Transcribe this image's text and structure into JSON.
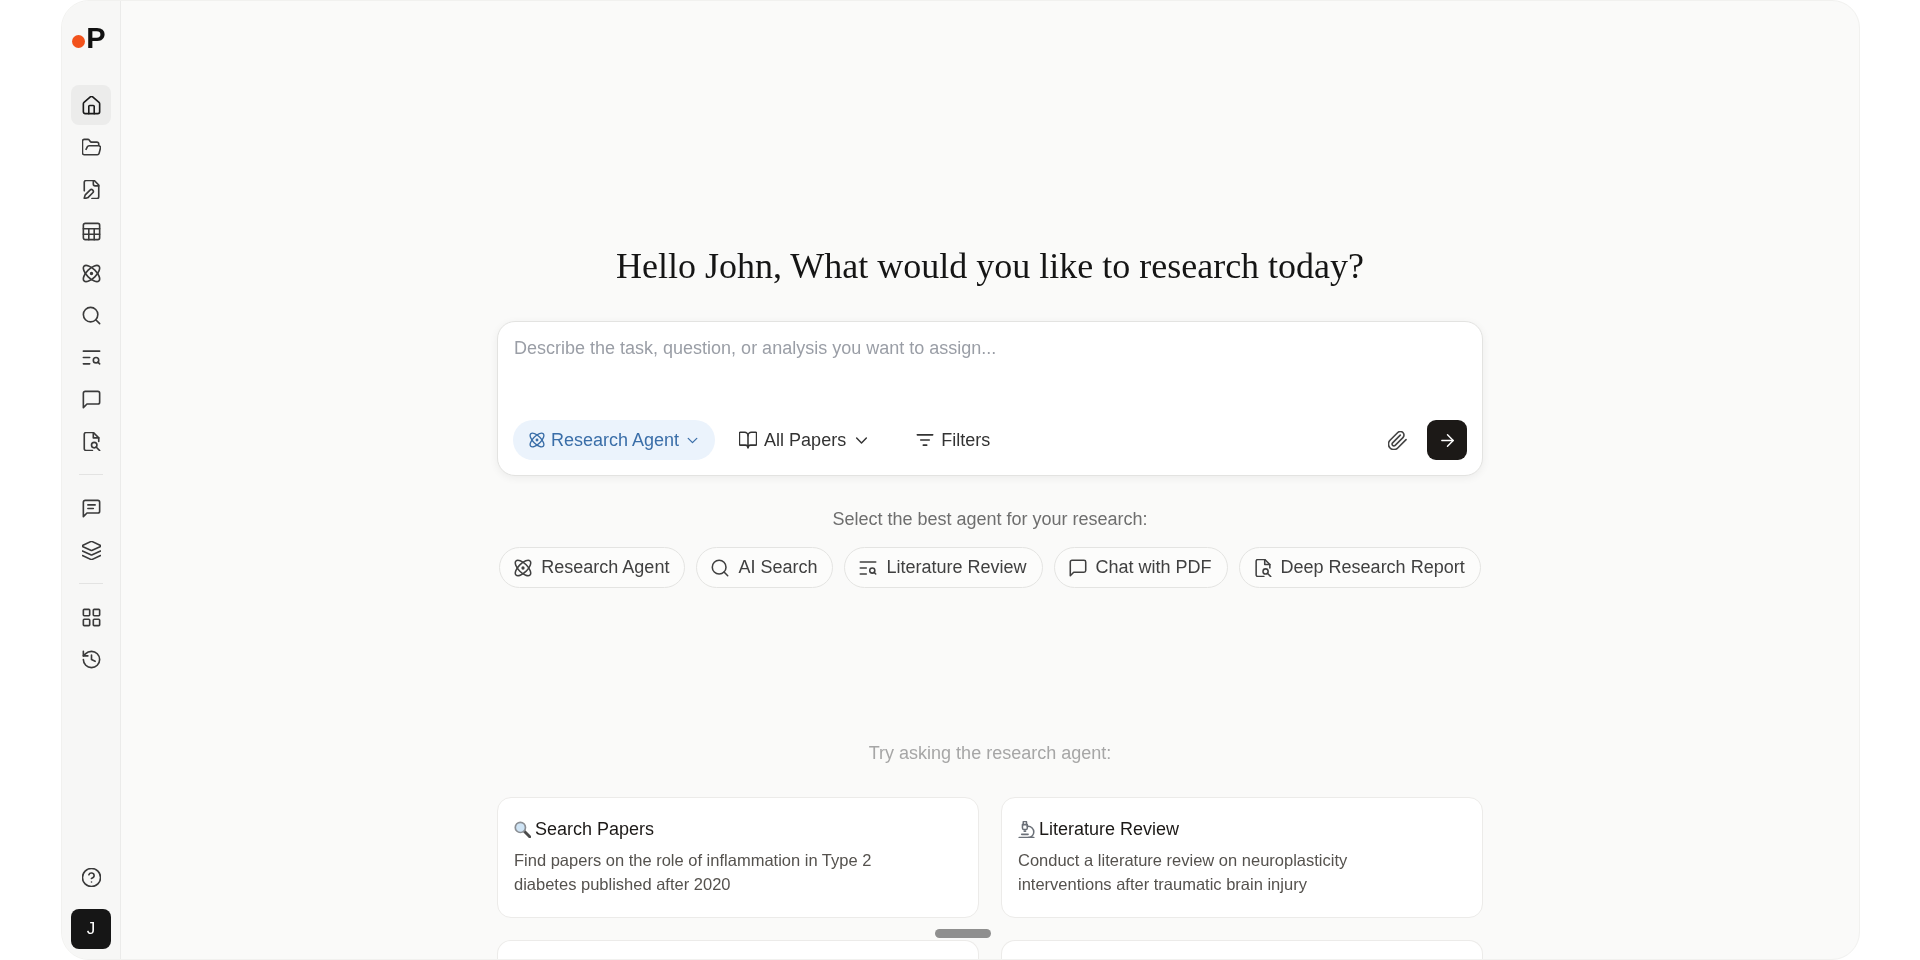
{
  "sidebar": {
    "logo": "P",
    "groups": [
      {
        "items": [
          {
            "selected": true
          },
          {
            "selected": false
          },
          {
            "selected": false
          },
          {
            "selected": false
          },
          {
            "selected": false
          },
          {
            "selected": false
          },
          {
            "selected": false
          },
          {
            "selected": false
          },
          {
            "selected": false
          }
        ]
      },
      {
        "items": [
          {
            "selected": false
          },
          {
            "selected": false
          }
        ]
      },
      {
        "items": [
          {
            "selected": false
          },
          {
            "selected": false
          }
        ]
      }
    ],
    "avatar": "J"
  },
  "greeting": "Hello John, What would you like to research today?",
  "prompt": {
    "placeholder": "Describe the task, question, or analysis you want to assign...",
    "agent_select": "Research Agent",
    "source_select": "All Papers",
    "filters": "Filters"
  },
  "agents": {
    "heading": "Select the best agent for your research:",
    "options": [
      "Research Agent",
      "AI Search",
      "Literature Review",
      "Chat with PDF",
      "Deep Research Report"
    ]
  },
  "examples": {
    "heading": "Try asking the research agent:",
    "cards": [
      {
        "kind": "example",
        "title": "Search Papers",
        "text": "Find papers on the role of inflammation in Type 2 diabetes published after 2020"
      },
      {
        "kind": "example",
        "title": "Literature Review",
        "text": "Conduct a literature review on neuroplasticity interventions after traumatic brain injury"
      },
      {
        "kind": "cut_off"
      },
      {
        "kind": "cut_off"
      }
    ]
  }
}
